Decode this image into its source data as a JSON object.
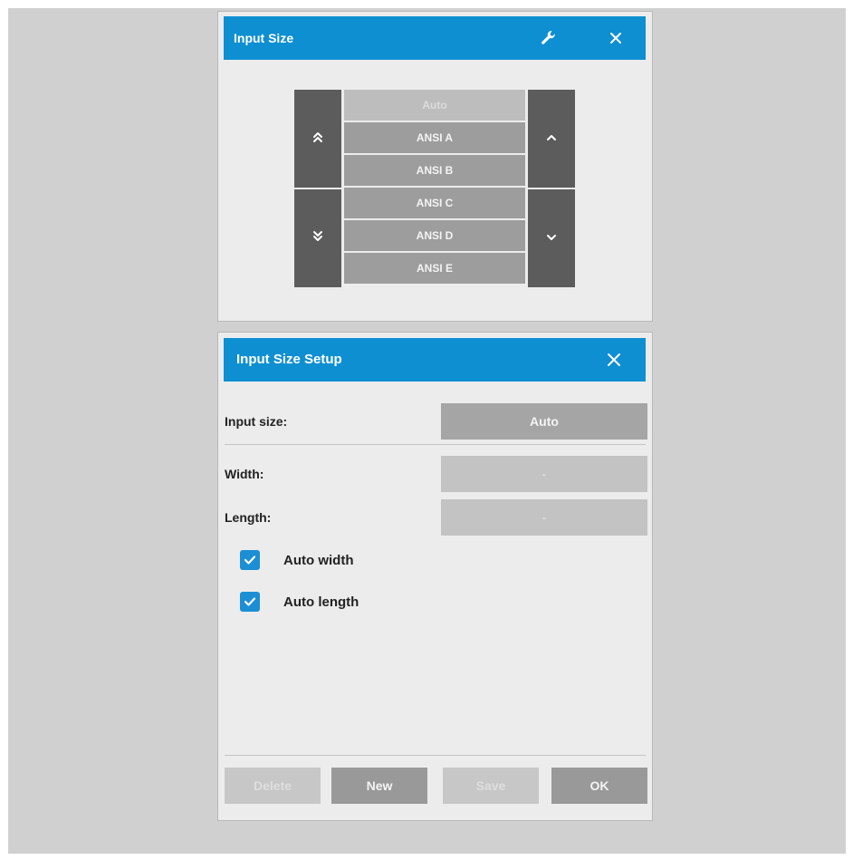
{
  "colors": {
    "titlebar": "#0e8fd1",
    "checkbox": "#1c8fd4",
    "scroll_button": "#5c5c5c",
    "list_item": "#9d9d9d",
    "panel_background": "#ececec"
  },
  "input_size_panel": {
    "title": "Input Size",
    "icons": [
      "wrench-icon",
      "close-icon"
    ],
    "scroll_icons": [
      "double-chevron-up-icon",
      "double-chevron-down-icon",
      "chevron-up-icon",
      "chevron-down-icon"
    ],
    "sizes": [
      {
        "label": "Auto",
        "enabled": false
      },
      {
        "label": "ANSI A",
        "enabled": true
      },
      {
        "label": "ANSI B",
        "enabled": true
      },
      {
        "label": "ANSI C",
        "enabled": true
      },
      {
        "label": "ANSI D",
        "enabled": true
      },
      {
        "label": "ANSI E",
        "enabled": true
      }
    ]
  },
  "setup_panel": {
    "title": "Input Size Setup",
    "input_size_label": "Input size:",
    "input_size_value": "Auto",
    "width_label": "Width:",
    "width_value": "-",
    "length_label": "Length:",
    "length_value": "-",
    "auto_width_label": "Auto width",
    "auto_width_checked": true,
    "auto_length_label": "Auto length",
    "auto_length_checked": true,
    "buttons": {
      "delete": "Delete",
      "new": "New",
      "save": "Save",
      "ok": "OK"
    }
  }
}
